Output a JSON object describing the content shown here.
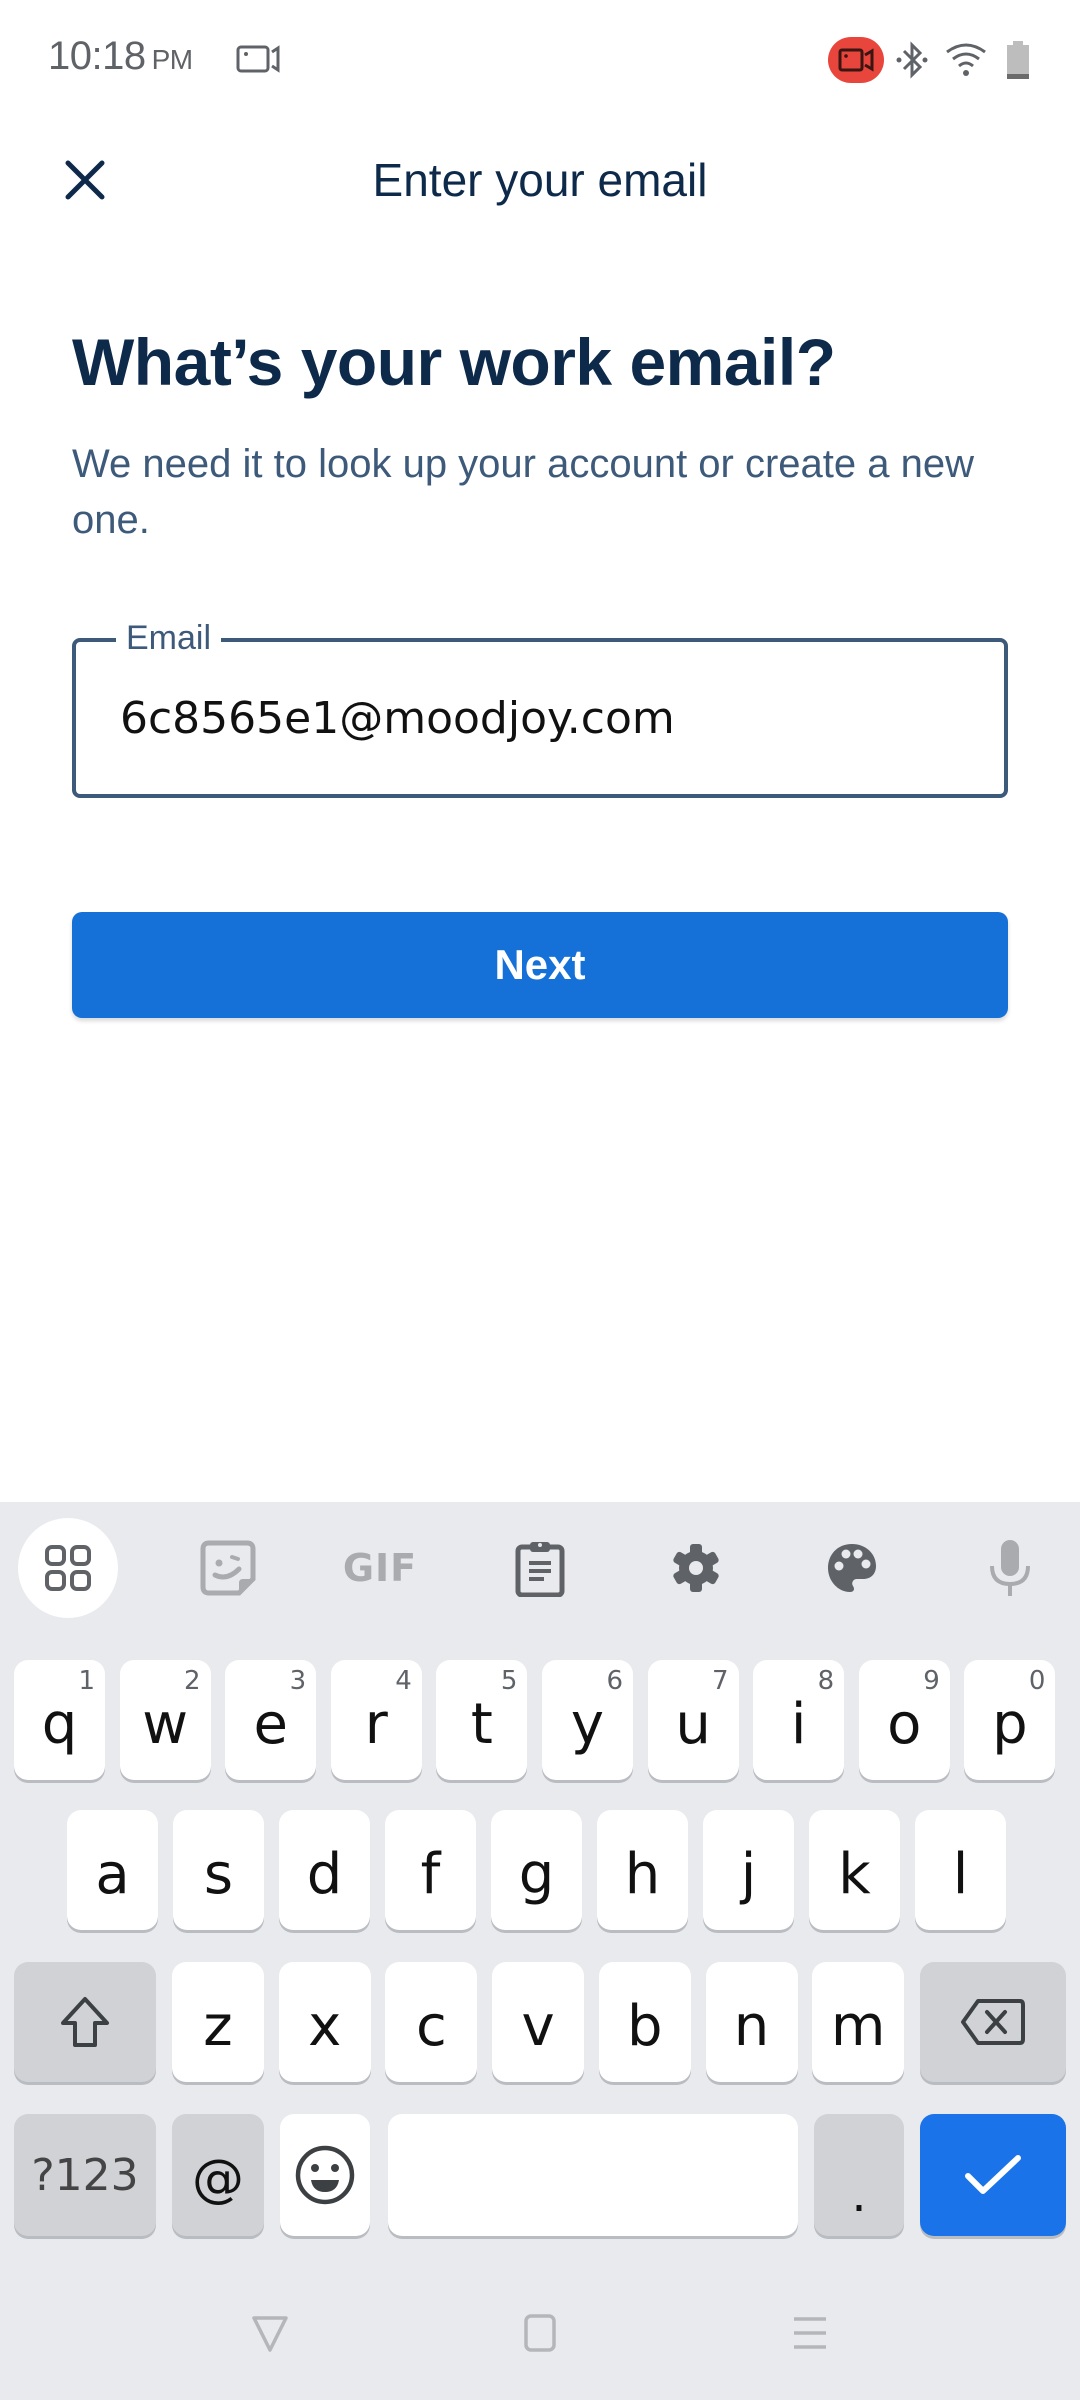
{
  "status_bar": {
    "time": "10:18",
    "ampm": "PM",
    "left_icons": [
      "screen-record-icon"
    ],
    "right_icons": [
      "camera-recording-icon",
      "bluetooth-icon",
      "wifi-icon",
      "battery-icon"
    ],
    "recording_color": "#e8453c"
  },
  "app_bar": {
    "close_icon": "close-icon",
    "title": "Enter your email"
  },
  "content": {
    "heading": "What’s your work email?",
    "subtitle": "We need it to look up your account or create a new one."
  },
  "email_field": {
    "label": "Email",
    "value": "6c8565e1@moodjoy.com",
    "border_color": "#3d5a7a"
  },
  "next_button": {
    "label": "Next",
    "color": "#1570d8"
  },
  "keyboard": {
    "toolbar": [
      {
        "name": "apps-grid-icon",
        "active": true
      },
      {
        "name": "sticker-icon",
        "active": false
      },
      {
        "name": "gif-icon",
        "label": "GIF",
        "active": false
      },
      {
        "name": "clipboard-icon",
        "active": false
      },
      {
        "name": "settings-gear-icon",
        "active": false
      },
      {
        "name": "theme-palette-icon",
        "active": false
      },
      {
        "name": "microphone-icon",
        "active": false
      }
    ],
    "row1": [
      {
        "key": "q",
        "hint": "1"
      },
      {
        "key": "w",
        "hint": "2"
      },
      {
        "key": "e",
        "hint": "3"
      },
      {
        "key": "r",
        "hint": "4"
      },
      {
        "key": "t",
        "hint": "5"
      },
      {
        "key": "y",
        "hint": "6"
      },
      {
        "key": "u",
        "hint": "7"
      },
      {
        "key": "i",
        "hint": "8"
      },
      {
        "key": "o",
        "hint": "9"
      },
      {
        "key": "p",
        "hint": "0"
      }
    ],
    "row2": [
      "a",
      "s",
      "d",
      "f",
      "g",
      "h",
      "j",
      "k",
      "l"
    ],
    "row3": [
      "z",
      "x",
      "c",
      "v",
      "b",
      "n",
      "m"
    ],
    "symbols_label": "?123",
    "at_label": "@",
    "period_label": ".",
    "enter_color": "#1a73e8"
  },
  "nav_bar": [
    "back-triangle-icon",
    "home-square-icon",
    "recents-menu-icon"
  ]
}
